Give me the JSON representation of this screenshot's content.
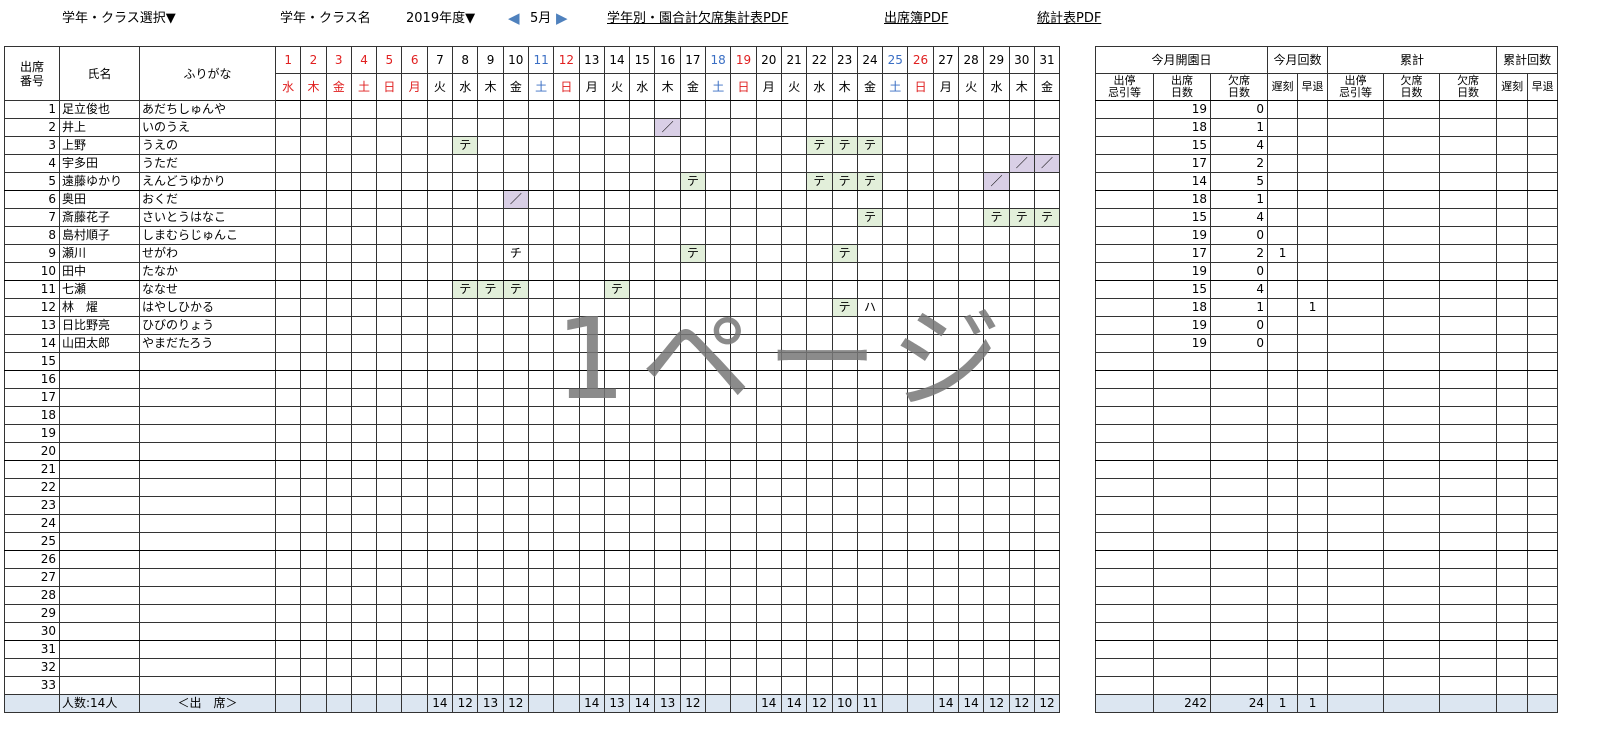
{
  "toolbar": {
    "grade_class_select": "学年・クラス選択▼",
    "grade_class_name": "学年・クラス名",
    "year": "2019年度▼",
    "prev_month": "◀",
    "month": "5月",
    "next_month": "▶",
    "pdf_summary": "学年別・園合計欠席集計表PDF",
    "pdf_attendance": "出席簿PDF",
    "pdf_stats": "統計表PDF"
  },
  "table": {
    "header_no": "出席番号",
    "header_no_line1": "出席",
    "header_no_line2": "番号",
    "header_name": "氏名",
    "header_kana": "ふりがな",
    "days": [
      "1",
      "2",
      "3",
      "4",
      "5",
      "6",
      "7",
      "8",
      "9",
      "10",
      "11",
      "12",
      "13",
      "14",
      "15",
      "16",
      "17",
      "18",
      "19",
      "20",
      "21",
      "22",
      "23",
      "24",
      "25",
      "26",
      "27",
      "28",
      "29",
      "30",
      "31"
    ],
    "weekdays": [
      "水",
      "木",
      "金",
      "土",
      "日",
      "月",
      "火",
      "水",
      "木",
      "金",
      "土",
      "日",
      "月",
      "火",
      "水",
      "木",
      "金",
      "土",
      "日",
      "月",
      "火",
      "水",
      "木",
      "金",
      "土",
      "日",
      "月",
      "火",
      "水",
      "木",
      "金"
    ],
    "red_days": [
      1,
      2,
      3,
      4,
      5,
      6,
      12,
      19,
      26
    ],
    "blue_days": [
      11,
      18,
      25
    ],
    "students": [
      {
        "no": "1",
        "name": "足立俊也",
        "kana": "あだちしゅんや"
      },
      {
        "no": "2",
        "name": "井上",
        "kana": "いのうえ"
      },
      {
        "no": "3",
        "name": "上野",
        "kana": "うえの"
      },
      {
        "no": "4",
        "name": "宇多田",
        "kana": "うただ"
      },
      {
        "no": "5",
        "name": "遠藤ゆかり",
        "kana": "えんどうゆかり"
      },
      {
        "no": "6",
        "name": "奥田",
        "kana": "おくだ"
      },
      {
        "no": "7",
        "name": "斎藤花子",
        "kana": "さいとうはなこ"
      },
      {
        "no": "8",
        "name": "島村順子",
        "kana": "しまむらじゅんこ"
      },
      {
        "no": "9",
        "name": "瀬川",
        "kana": "せがわ"
      },
      {
        "no": "10",
        "name": "田中",
        "kana": "たなか"
      },
      {
        "no": "11",
        "name": "七瀬",
        "kana": "ななせ"
      },
      {
        "no": "12",
        "name": "林　燿",
        "kana": "はやしひかる"
      },
      {
        "no": "13",
        "name": "日比野亮",
        "kana": "ひびのりょう"
      },
      {
        "no": "14",
        "name": "山田太郎",
        "kana": "やまだたろう"
      },
      {
        "no": "15",
        "name": "",
        "kana": ""
      },
      {
        "no": "16",
        "name": "",
        "kana": ""
      },
      {
        "no": "17",
        "name": "",
        "kana": ""
      },
      {
        "no": "18",
        "name": "",
        "kana": ""
      },
      {
        "no": "19",
        "name": "",
        "kana": ""
      },
      {
        "no": "20",
        "name": "",
        "kana": ""
      },
      {
        "no": "21",
        "name": "",
        "kana": ""
      },
      {
        "no": "22",
        "name": "",
        "kana": ""
      },
      {
        "no": "23",
        "name": "",
        "kana": ""
      },
      {
        "no": "24",
        "name": "",
        "kana": ""
      },
      {
        "no": "25",
        "name": "",
        "kana": ""
      },
      {
        "no": "26",
        "name": "",
        "kana": ""
      },
      {
        "no": "27",
        "name": "",
        "kana": ""
      },
      {
        "no": "28",
        "name": "",
        "kana": ""
      },
      {
        "no": "29",
        "name": "",
        "kana": ""
      },
      {
        "no": "30",
        "name": "",
        "kana": ""
      },
      {
        "no": "31",
        "name": "",
        "kana": ""
      },
      {
        "no": "32",
        "name": "",
        "kana": ""
      },
      {
        "no": "33",
        "name": "",
        "kana": ""
      }
    ],
    "marks": [
      {
        "row": 2,
        "day": 16,
        "text": "／",
        "style": "slash"
      },
      {
        "row": 3,
        "day": 8,
        "text": "テ",
        "style": "te"
      },
      {
        "row": 3,
        "day": 22,
        "text": "テ",
        "style": "te"
      },
      {
        "row": 3,
        "day": 23,
        "text": "テ",
        "style": "te"
      },
      {
        "row": 3,
        "day": 24,
        "text": "テ",
        "style": "te"
      },
      {
        "row": 4,
        "day": 30,
        "text": "／",
        "style": "slash"
      },
      {
        "row": 4,
        "day": 31,
        "text": "／",
        "style": "slash"
      },
      {
        "row": 5,
        "day": 17,
        "text": "テ",
        "style": "te"
      },
      {
        "row": 5,
        "day": 22,
        "text": "テ",
        "style": "te"
      },
      {
        "row": 5,
        "day": 23,
        "text": "テ",
        "style": "te"
      },
      {
        "row": 5,
        "day": 24,
        "text": "テ",
        "style": "te"
      },
      {
        "row": 5,
        "day": 29,
        "text": "／",
        "style": "slash"
      },
      {
        "row": 6,
        "day": 10,
        "text": "／",
        "style": "slash"
      },
      {
        "row": 7,
        "day": 24,
        "text": "テ",
        "style": "te"
      },
      {
        "row": 7,
        "day": 29,
        "text": "テ",
        "style": "te"
      },
      {
        "row": 7,
        "day": 30,
        "text": "テ",
        "style": "te"
      },
      {
        "row": 7,
        "day": 31,
        "text": "テ",
        "style": "te"
      },
      {
        "row": 9,
        "day": 10,
        "text": "チ",
        "style": "plain"
      },
      {
        "row": 9,
        "day": 17,
        "text": "テ",
        "style": "te"
      },
      {
        "row": 9,
        "day": 23,
        "text": "テ",
        "style": "te"
      },
      {
        "row": 11,
        "day": 8,
        "text": "テ",
        "style": "te"
      },
      {
        "row": 11,
        "day": 9,
        "text": "テ",
        "style": "te"
      },
      {
        "row": 11,
        "day": 10,
        "text": "テ",
        "style": "te"
      },
      {
        "row": 11,
        "day": 14,
        "text": "テ",
        "style": "te"
      },
      {
        "row": 12,
        "day": 23,
        "text": "テ",
        "style": "te"
      },
      {
        "row": 12,
        "day": 24,
        "text": "ハ",
        "style": "plain"
      }
    ],
    "footer_count": "人数:14人",
    "footer_label": "＜出　席＞",
    "footer_daily": {
      "7": "14",
      "8": "12",
      "9": "13",
      "10": "12",
      "13": "14",
      "14": "13",
      "15": "14",
      "16": "13",
      "17": "12",
      "20": "14",
      "21": "14",
      "22": "12",
      "23": "10",
      "24": "11",
      "27": "14",
      "28": "14",
      "29": "12",
      "30": "12",
      "31": "12"
    }
  },
  "stats": {
    "group_open_days": "今月開園日",
    "group_month_count": "今月回数",
    "group_cumulative": "累計",
    "group_cum_count": "累計回数",
    "col_suspension": "出停忌引等",
    "col_suspension_l1": "出停",
    "col_suspension_l2": "忌引等",
    "col_attend_l1": "出席",
    "col_attend_l2": "日数",
    "col_absent_l1": "欠席",
    "col_absent_l2": "日数",
    "col_late": "遅刻",
    "col_early": "早退",
    "rows": [
      {
        "susp": "",
        "attend": "19",
        "absent": "0",
        "late": "",
        "early": ""
      },
      {
        "susp": "",
        "attend": "18",
        "absent": "1",
        "late": "",
        "early": ""
      },
      {
        "susp": "",
        "attend": "15",
        "absent": "4",
        "late": "",
        "early": ""
      },
      {
        "susp": "",
        "attend": "17",
        "absent": "2",
        "late": "",
        "early": ""
      },
      {
        "susp": "",
        "attend": "14",
        "absent": "5",
        "late": "",
        "early": ""
      },
      {
        "susp": "",
        "attend": "18",
        "absent": "1",
        "late": "",
        "early": ""
      },
      {
        "susp": "",
        "attend": "15",
        "absent": "4",
        "late": "",
        "early": ""
      },
      {
        "susp": "",
        "attend": "19",
        "absent": "0",
        "late": "",
        "early": ""
      },
      {
        "susp": "",
        "attend": "17",
        "absent": "2",
        "late": "1",
        "early": ""
      },
      {
        "susp": "",
        "attend": "19",
        "absent": "0",
        "late": "",
        "early": ""
      },
      {
        "susp": "",
        "attend": "15",
        "absent": "4",
        "late": "",
        "early": ""
      },
      {
        "susp": "",
        "attend": "18",
        "absent": "1",
        "late": "",
        "early": "1"
      },
      {
        "susp": "",
        "attend": "19",
        "absent": "0",
        "late": "",
        "early": ""
      },
      {
        "susp": "",
        "attend": "19",
        "absent": "0",
        "late": "",
        "early": ""
      }
    ],
    "total": {
      "attend": "242",
      "absent": "24",
      "late": "1",
      "early": "1"
    }
  },
  "watermark": "1ページ",
  "colors": {
    "te_fill": "#e2efda",
    "slash_fill": "#d9cfe6",
    "footer_fill": "#dce6f1",
    "red": "#e02020",
    "blue": "#3b6fc4",
    "arrow": "#4f81bd"
  }
}
